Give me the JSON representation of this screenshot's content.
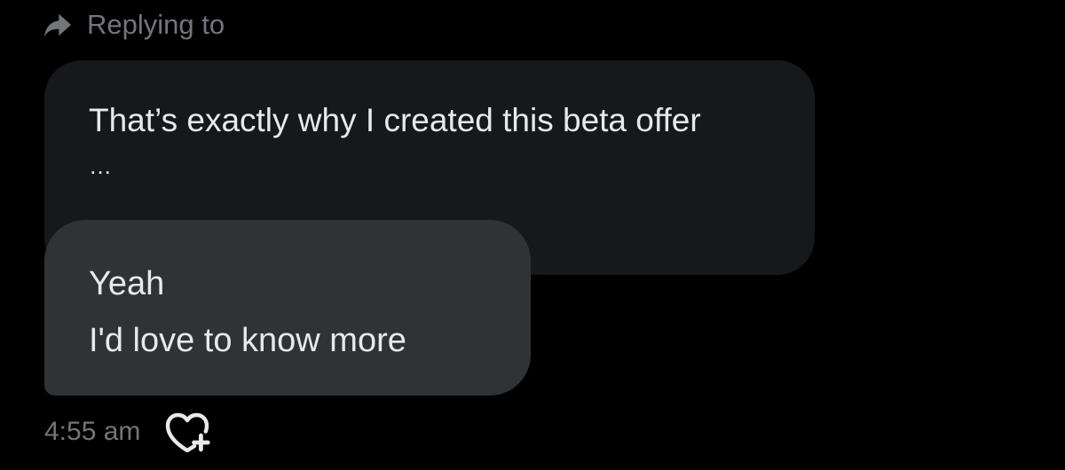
{
  "header": {
    "replying_label": "Replying to",
    "icon": "reply-arrow-icon"
  },
  "quoted_message": {
    "text": "That’s exactly why I created this beta offer",
    "ellipsis": "…"
  },
  "reply_message": {
    "line1": "Yeah",
    "line2": "I'd love to know more"
  },
  "meta": {
    "timestamp": "4:55 am",
    "react_icon": "heart-plus-icon"
  },
  "colors": {
    "background": "#000000",
    "quoted_bubble": "#16181c",
    "reply_bubble": "#2f3336",
    "text_primary": "#e7e9ea",
    "text_secondary": "#71767b"
  }
}
